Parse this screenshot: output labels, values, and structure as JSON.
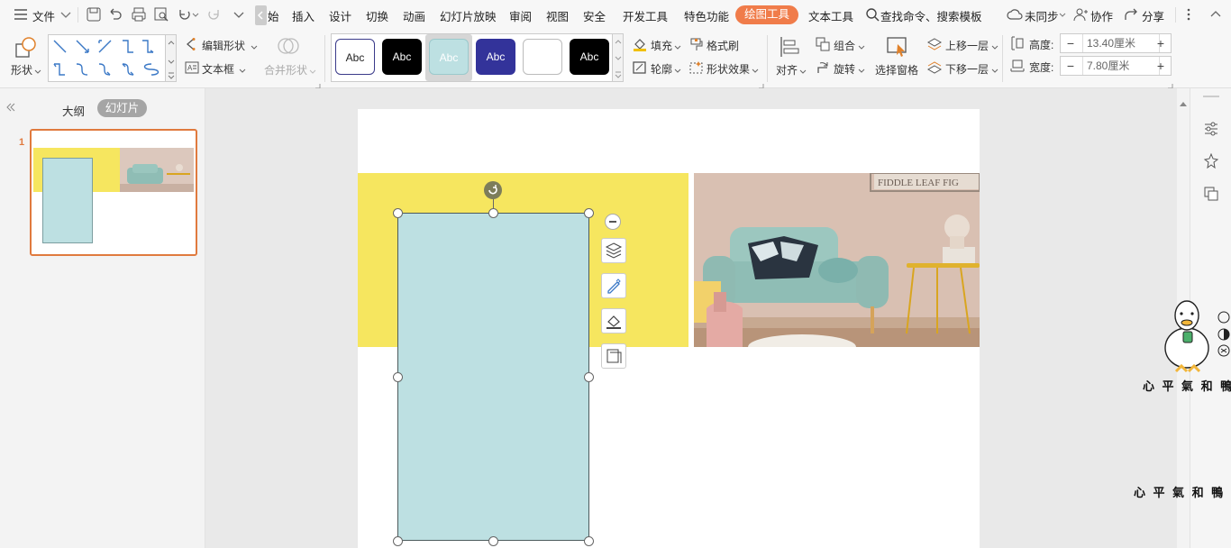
{
  "menubar": {
    "file": "文件",
    "tabs": [
      "始",
      "插入",
      "设计",
      "切换",
      "动画",
      "幻灯片放映",
      "审阅",
      "视图",
      "安全",
      "开发工具",
      "特色功能",
      "绘图工具",
      "文本工具"
    ],
    "active_tab": "绘图工具",
    "search": "查找命令、搜索模板",
    "sync": "未同步",
    "collab": "协作",
    "share": "分享"
  },
  "ribbon": {
    "shape": "形状",
    "edit_shape": "编辑形状",
    "textbox": "文本框",
    "merge_shape": "合并形状",
    "style_samples": [
      "Abc",
      "Abc",
      "Abc",
      "Abc",
      "",
      "Abc"
    ],
    "fill": "填充",
    "format_painter": "格式刷",
    "outline": "轮廓",
    "shape_effect": "形状效果",
    "align": "对齐",
    "group": "组合",
    "rotate": "旋转",
    "selection_pane": "选择窗格",
    "bring_forward": "上移一层",
    "send_backward": "下移一层",
    "height_label": "高度:",
    "height_value": "13.40厘米",
    "width_label": "宽度:",
    "width_value": "7.80厘米"
  },
  "leftpane": {
    "outline_tab": "大纲",
    "slides_tab": "幻灯片",
    "slide_number": "1"
  },
  "slide": {
    "picture_sign": "FIDDLE LEAF FIG"
  },
  "watermark": "心 平 氣 和 鴨",
  "colors": {
    "accent": "#f07c4a",
    "yellow": "#f6e65f",
    "teal_shape": "#bde0e2",
    "navy_style": "#33339a"
  }
}
